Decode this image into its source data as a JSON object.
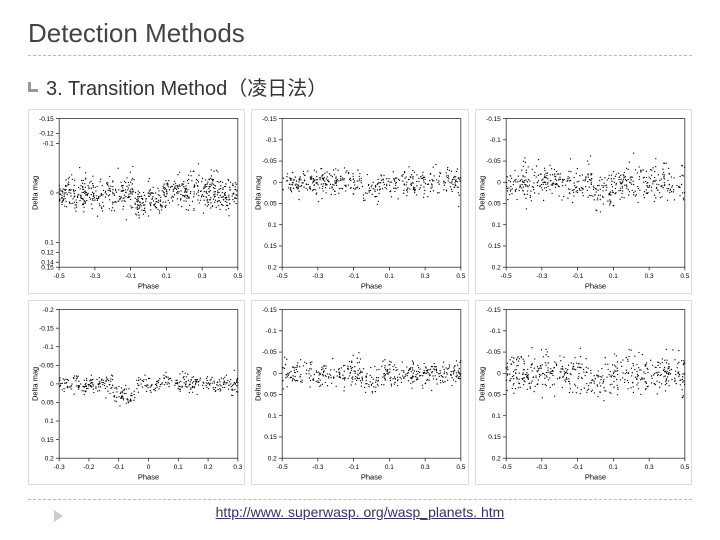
{
  "title": "Detection Methods",
  "subtitle": "3. Transition Method（凌日法）",
  "link_text": "http://www. superwasp. org/wasp_planets. htm",
  "chart_data": [
    {
      "type": "scatter",
      "xlabel": "Phase",
      "ylabel": "Delta mag",
      "xlim": [
        -0.5,
        0.5
      ],
      "ylim": [
        -0.15,
        0.15
      ],
      "x_ticks": [
        -0.5,
        -0.3,
        -0.1,
        0.1,
        0.3,
        0.5
      ],
      "y_ticks": [
        -0.15,
        -0.12,
        -0.1,
        0,
        0.1,
        0.12,
        0.14,
        0.15
      ],
      "dip_center": 0.0,
      "dip_halfwidth": 0.08,
      "dip_depth": 0.015,
      "noise_sigma": 0.018,
      "n_points": 700
    },
    {
      "type": "scatter",
      "xlabel": "Phase",
      "ylabel": "Delta mag",
      "xlim": [
        -0.5,
        0.5
      ],
      "ylim": [
        -0.15,
        0.2
      ],
      "x_ticks": [
        -0.5,
        -0.3,
        -0.1,
        0.1,
        0.3,
        0.5
      ],
      "y_ticks": [
        -0.15,
        -0.1,
        -0.05,
        0,
        0.05,
        0.1,
        0.15,
        0.2
      ],
      "dip_center": 0.0,
      "dip_halfwidth": 0.05,
      "dip_depth": 0.02,
      "noise_sigma": 0.015,
      "n_points": 450
    },
    {
      "type": "scatter",
      "xlabel": "Phase",
      "ylabel": "Delta mag",
      "xlim": [
        -0.5,
        0.5
      ],
      "ylim": [
        -0.15,
        0.2
      ],
      "x_ticks": [
        -0.5,
        -0.3,
        -0.1,
        0.1,
        0.3,
        0.5
      ],
      "y_ticks": [
        -0.15,
        -0.1,
        -0.05,
        0,
        0.05,
        0.1,
        0.15,
        0.2
      ],
      "dip_center": 0.05,
      "dip_halfwidth": 0.06,
      "dip_depth": 0.018,
      "noise_sigma": 0.02,
      "n_points": 500
    },
    {
      "type": "scatter",
      "xlabel": "Phase",
      "ylabel": "Delta mag",
      "xlim": [
        -0.3,
        0.3
      ],
      "ylim": [
        -0.2,
        0.2
      ],
      "x_ticks": [
        -0.3,
        -0.2,
        -0.1,
        0,
        0.1,
        0.2,
        0.3
      ],
      "y_ticks": [
        -0.2,
        -0.15,
        -0.1,
        -0.05,
        0,
        0.05,
        0.1,
        0.15,
        0.2
      ],
      "dip_center": -0.08,
      "dip_halfwidth": 0.04,
      "dip_depth": 0.03,
      "noise_sigma": 0.012,
      "n_points": 400
    },
    {
      "type": "scatter",
      "xlabel": "Phase",
      "ylabel": "Delta mag",
      "xlim": [
        -0.5,
        0.5
      ],
      "ylim": [
        -0.15,
        0.2
      ],
      "x_ticks": [
        -0.5,
        -0.3,
        -0.1,
        0.1,
        0.3,
        0.5
      ],
      "y_ticks": [
        -0.15,
        -0.1,
        -0.05,
        0,
        0.05,
        0.1,
        0.15,
        0.2
      ],
      "dip_center": 0.0,
      "dip_halfwidth": 0.06,
      "dip_depth": 0.015,
      "noise_sigma": 0.015,
      "n_points": 450
    },
    {
      "type": "scatter",
      "xlabel": "Phase",
      "ylabel": "Delta mag",
      "xlim": [
        -0.5,
        0.5
      ],
      "ylim": [
        -0.15,
        0.2
      ],
      "x_ticks": [
        -0.5,
        -0.3,
        -0.1,
        0.1,
        0.3,
        0.5
      ],
      "y_ticks": [
        -0.15,
        -0.1,
        -0.05,
        0,
        0.05,
        0.1,
        0.15,
        0.2
      ],
      "dip_center": 0.0,
      "dip_halfwidth": 0.05,
      "dip_depth": 0.02,
      "noise_sigma": 0.022,
      "n_points": 500
    }
  ]
}
